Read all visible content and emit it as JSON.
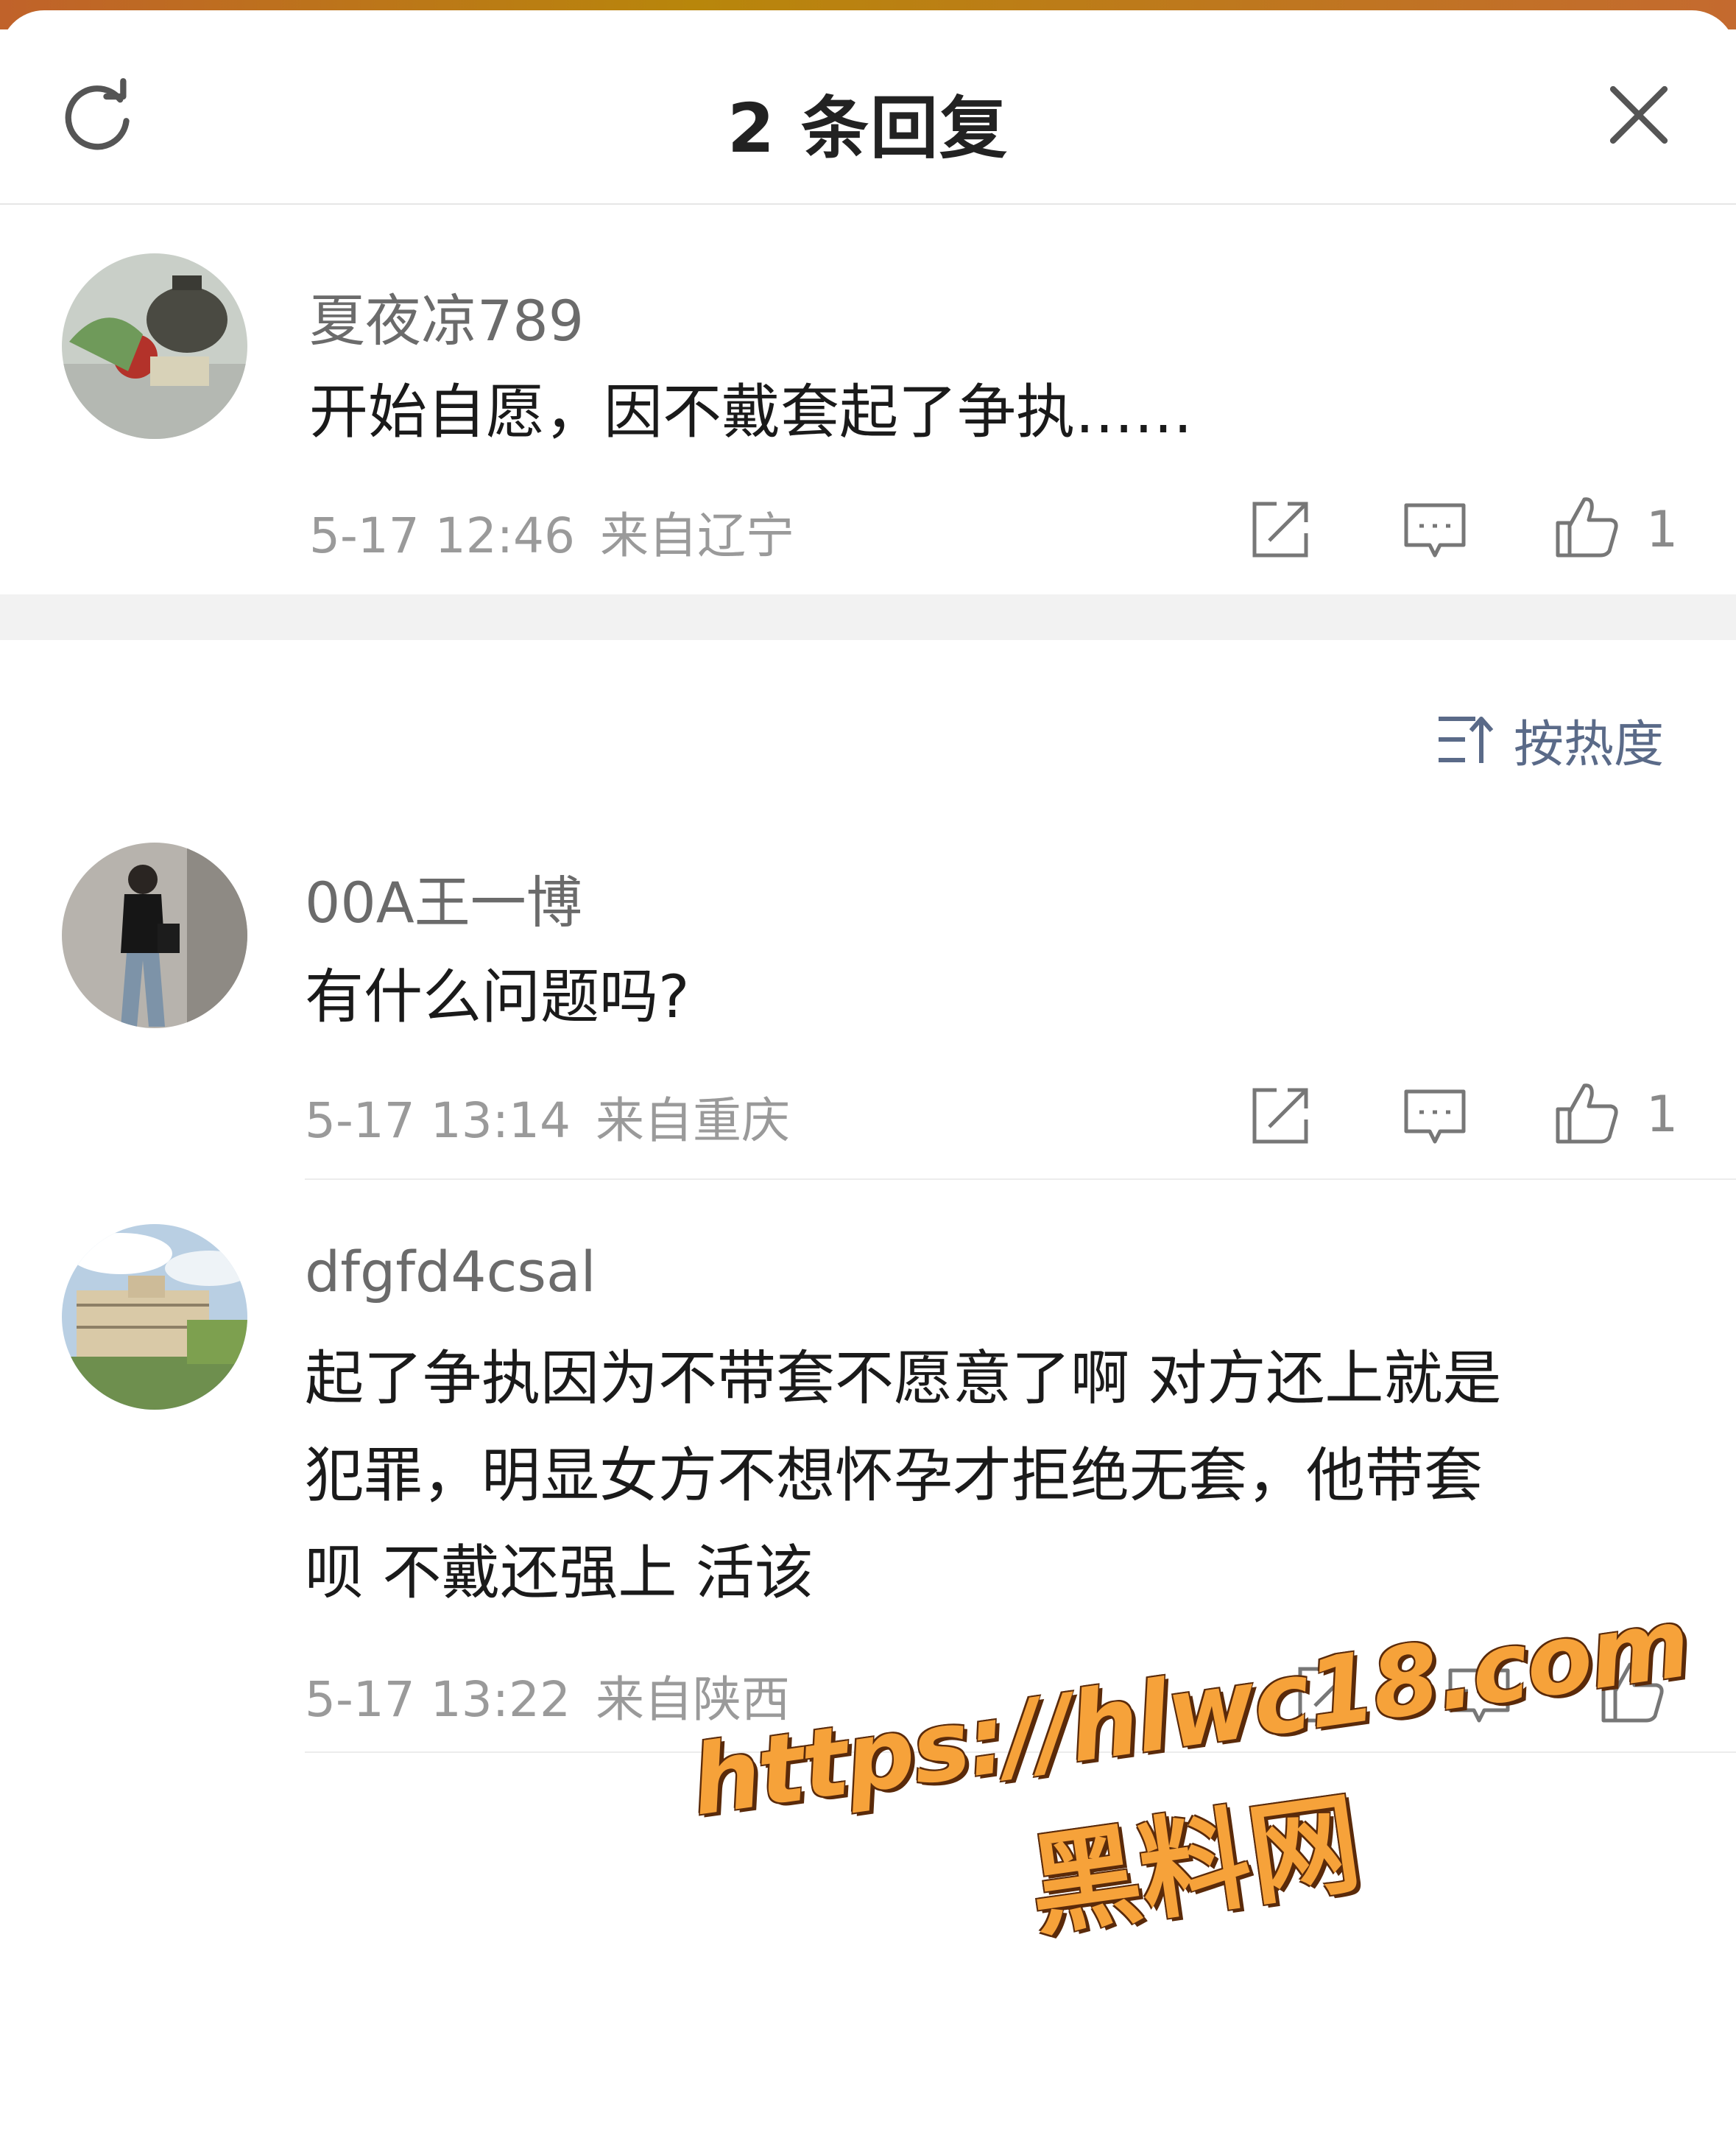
{
  "header": {
    "title": "2 条回复",
    "refresh_icon": "refresh-icon",
    "close_icon": "close-icon"
  },
  "root_comment": {
    "username": "夏夜凉789",
    "text": "开始自愿，因不戴套起了争执……",
    "time": "5-17 12:46",
    "location": "来自辽宁",
    "like_count": "1"
  },
  "sort": {
    "label": "按热度",
    "icon": "sort-icon"
  },
  "replies": [
    {
      "username": "00A王一博",
      "text": "有什么问题吗?",
      "time": "5-17 13:14",
      "location": "来自重庆",
      "like_count": "1"
    },
    {
      "username": "dfgfd4csal",
      "text_lines": [
        "起了争执因为不带套不愿意了啊  对方还上就是",
        "犯罪，明显女方不想怀孕才拒绝无套，他带套",
        "呗 不戴还强上 活该"
      ],
      "time": "5-17 13:22",
      "location": "来自陕西",
      "like_count": ""
    }
  ],
  "watermark": {
    "url": "https://hlwc18.com",
    "name": "黑料网"
  },
  "colors": {
    "accent_sort": "#5a6a88",
    "meta_gray": "#9a9a9a",
    "watermark_orange": "#f6a23a"
  }
}
